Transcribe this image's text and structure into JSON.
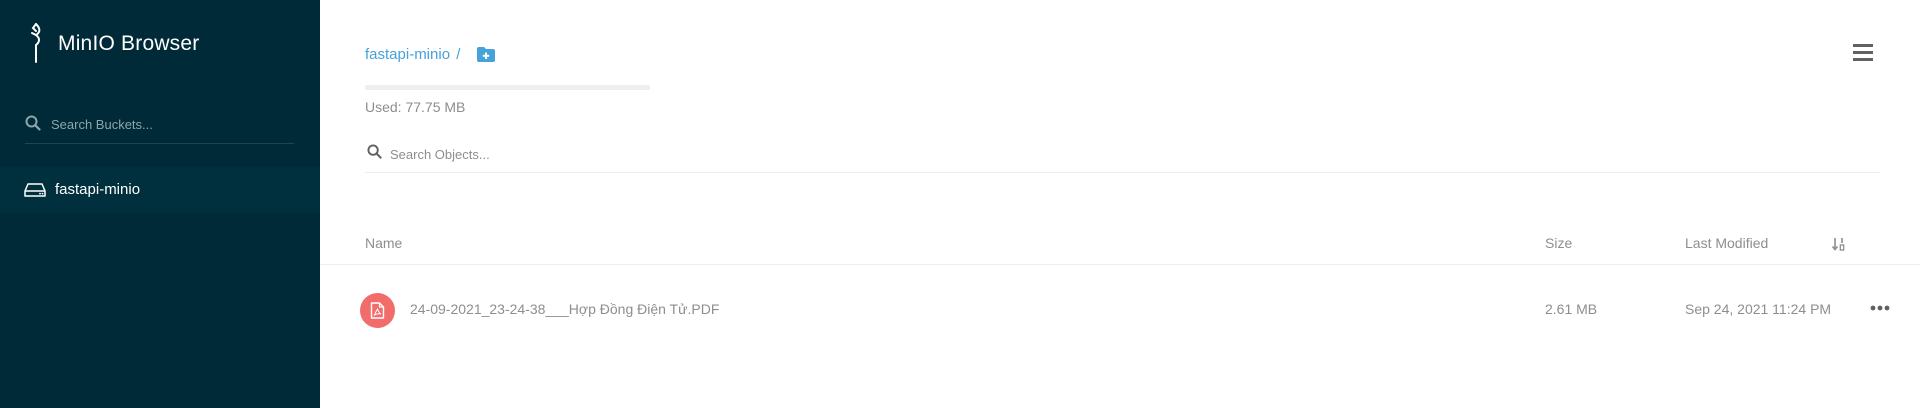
{
  "sidebar": {
    "app_title": "MinIO Browser",
    "logo_icon": "minio-heron-logo-icon",
    "search": {
      "placeholder": "Search Buckets...",
      "value": "",
      "icon": "search-icon"
    },
    "buckets": [
      {
        "label": "fastapi-minio",
        "icon": "hard-drive-icon",
        "active": true
      }
    ],
    "colors": {
      "background": "#002a37",
      "active_item": "#00303d"
    }
  },
  "header": {
    "breadcrumb": {
      "bucket": "fastapi-minio",
      "separator": "/"
    },
    "folder_add_icon": "folder-plus-icon",
    "menu_icon": "hamburger-menu-icon",
    "usage": {
      "text": "Used: 77.75 MB",
      "fill_fraction": 0.0
    },
    "search": {
      "placeholder": "Search Objects...",
      "value": "",
      "icon": "search-icon"
    }
  },
  "table": {
    "columns": [
      "Name",
      "Size",
      "Last Modified"
    ],
    "sort_icon": "sort-numeric-icon",
    "rows": [
      {
        "name": "24-09-2021_23-24-38___Hợp Đồng Điện Tử.PDF",
        "size": "2.61 MB",
        "modified": "Sep 24, 2021 11:24 PM",
        "file_icon": "pdf-file-icon",
        "actions_icon": "more-horizontal-icon"
      }
    ]
  },
  "colors": {
    "accent": "#46a2d9",
    "pdf_badge": "#f26c6c",
    "text_muted": "#8e8e8e"
  }
}
